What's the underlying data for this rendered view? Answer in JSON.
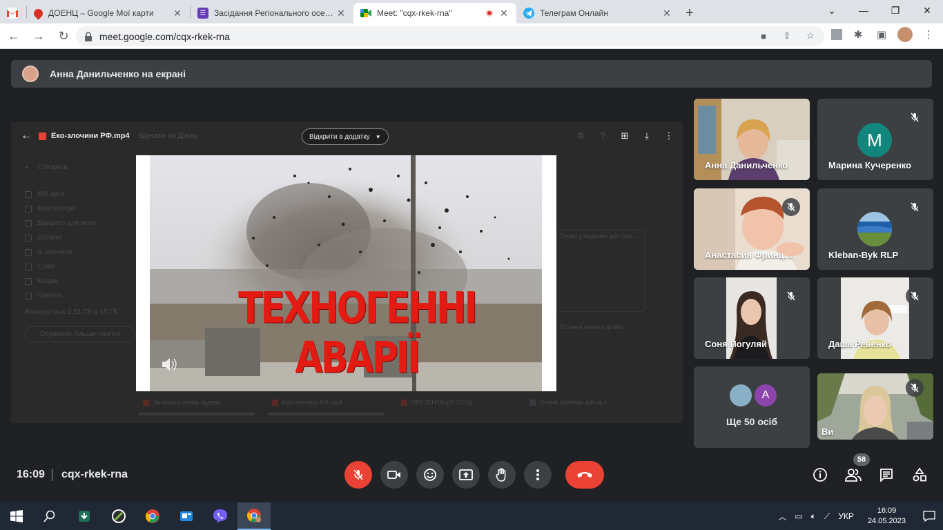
{
  "browser": {
    "tabs": [
      {
        "title": "",
        "favicon": "gmail-icon",
        "color": "#ea4335"
      },
      {
        "title": "ДОЕНЦ – Google Мої карти",
        "favicon": "maps-icon",
        "color": "#d93025"
      },
      {
        "title": "Засідання Регіонального осере…",
        "favicon": "forms-icon",
        "color": "#673ab7"
      },
      {
        "title": "Meet: \"cqx-rkek-rna\"",
        "favicon": "meet-icon",
        "color": "#00832d",
        "active": true
      },
      {
        "title": "Телеграм Онлайн",
        "favicon": "telegram-icon",
        "color": "#2aabee"
      }
    ],
    "url": "meet.google.com/cqx-rkek-rna"
  },
  "meet": {
    "presenting_text": "Анна Данильченко на екрані",
    "shared_screen": {
      "file_name": "Еко-злочини РФ.mp4",
      "search_placeholder": "Шукати на Диску",
      "open_with_label": "Відкрити в додатку",
      "video_title": "ТЕХНОГЕННІ АВАРІЇ",
      "drive_sidebar": [
        "Створити",
        "Мій диск",
        "Комп'ютери",
        "Відкрито для мене",
        "Останні",
        "Із зірочкою",
        "Спам",
        "Кошик",
        "Пам'ять"
      ],
      "storage_text": "Використано 2,51 ГБ із 15 ГБ",
      "storage_button": "Отримати більше пам'яті",
      "bottom_files": [
        "Загальна схема будови…",
        "Еко-злочини РФ.mp4",
        "ПРЕЗЕНТАЦІЯ СТУД…",
        "Вплив бойових дій на т…"
      ],
      "right_text": [
        "Тепер у надання доступу…",
        "Останні зміни в файлі"
      ]
    },
    "participants": [
      {
        "name": "Анна Данильченко",
        "type": "video",
        "muted": false
      },
      {
        "name": "Марина Кучеренко",
        "type": "avatar",
        "initial": "M",
        "avatar_color": "#12867c",
        "muted": true
      },
      {
        "name": "Анастасия Фринц…",
        "type": "video",
        "muted": true
      },
      {
        "name": "Kleban-Byk RLP",
        "type": "avatar-image",
        "muted": true
      },
      {
        "name": "Соня Погуляй",
        "type": "video",
        "muted": true
      },
      {
        "name": "Даша Ревенко",
        "type": "video",
        "muted": true
      },
      {
        "name": "Ще 50 осіб",
        "type": "others",
        "initial": "A",
        "avatar_color": "#8e44ad"
      },
      {
        "name": "Ви",
        "type": "video",
        "muted": true
      }
    ],
    "bottom": {
      "time": "16:09",
      "meeting_code": "cqx-rkek-rna",
      "participant_count": "58"
    }
  },
  "taskbar": {
    "language": "УКР",
    "time": "16:09",
    "date": "24.05.2023"
  }
}
